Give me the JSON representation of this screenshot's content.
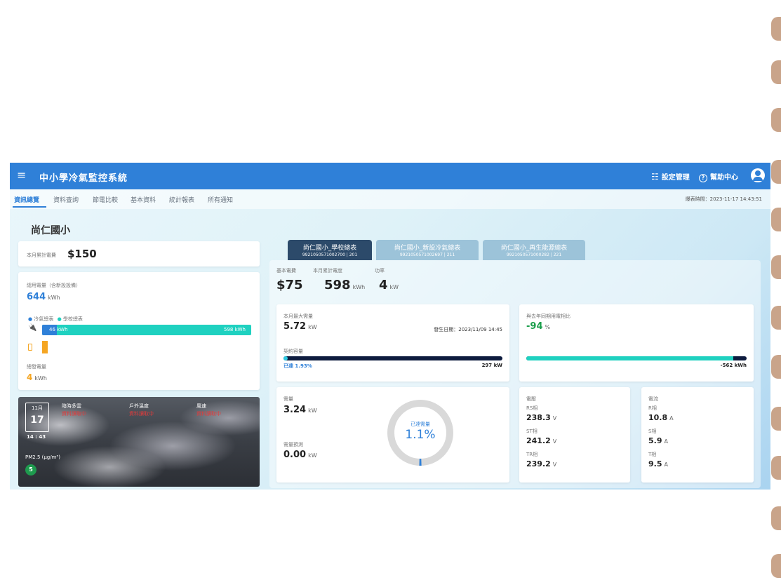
{
  "app": {
    "title": "中小學冷氣監控系統",
    "menu_icon": "hamburger-icon",
    "settings_label": "設定管理",
    "help_label": "幫助中心",
    "user_icon": "account-circle-icon"
  },
  "nav": {
    "tabs": [
      "資訊總覽",
      "資料查詢",
      "節電比較",
      "基本資料",
      "統計報表",
      "所有通知"
    ],
    "active_index": 0,
    "update_time": "爆表時間：2023-11-17 14:43:51"
  },
  "school_name": "尚仁國小",
  "left": {
    "monthly_cost_label": "本月累計電費",
    "monthly_cost": "$150",
    "usage_label": "總用電量（含新設設備）",
    "usage_value": "644",
    "usage_unit": "kWh",
    "legend_ac": "冷氣總表",
    "legend_school": "學校總表",
    "bar_ac_value": "46 kWh",
    "bar_school_value": "598 kWh",
    "bar_ac_fraction": 0.07,
    "gen_label": "總發電量",
    "gen_value": "4",
    "gen_unit": "kWh",
    "colors": {
      "ac": "#2f80d8",
      "school": "#1fd1c0",
      "gen": "#f5a623"
    }
  },
  "weather": {
    "month": "11月",
    "day": "17",
    "time": "14 : 43",
    "weather_label": "陰時多雲",
    "weather_value": "資料讀取中",
    "temp_label": "戶外溫度",
    "temp_value": "資料讀取中",
    "wind_label": "風速",
    "wind_value": "資料讀取中",
    "pm_label": "PM2.5 (μg/m³)",
    "pm_value": "5"
  },
  "meters": [
    {
      "name": "尚仁國小_學校總表",
      "code": "9921050571002700 | 201",
      "active": true
    },
    {
      "name": "尚仁國小_新設冷氣總表",
      "code": "9921050571002697 | 211",
      "active": false
    },
    {
      "name": "尚仁國小_再生能源總表",
      "code": "9921050571000282 | 221",
      "active": false
    }
  ],
  "summary": {
    "basic_fee_label": "基本電費",
    "basic_fee": "$75",
    "month_usage_label": "本月累計電度",
    "month_usage": "598",
    "month_usage_unit": "kWh",
    "power_label": "功率",
    "power": "4",
    "power_unit": "kW"
  },
  "max_demand": {
    "label": "本月最大需量",
    "value": "5.72",
    "unit": "kW",
    "date": "發生日期：2023/11/09 14:45",
    "contract_label": "契約容量",
    "used": "已達 1.93%",
    "used_fraction": 0.0193,
    "capacity": "297 kW"
  },
  "compare": {
    "label": "與去年同期用電相比",
    "value": "-94",
    "unit": "%",
    "diff": "-562 kWh",
    "fraction": 0.94
  },
  "demand": {
    "label": "需量",
    "value": "3.24",
    "unit": "kW",
    "forecast_label": "需量預測",
    "forecast_value": "0.00",
    "forecast_unit": "kW",
    "ring_label": "已達需量",
    "ring_value": "1.1%",
    "ring_fraction": 0.011
  },
  "voltage": {
    "title": "電壓",
    "items": [
      {
        "label": "RS相",
        "value": "238.3",
        "unit": "V"
      },
      {
        "label": "ST相",
        "value": "241.2",
        "unit": "V"
      },
      {
        "label": "TR相",
        "value": "239.2",
        "unit": "V"
      }
    ]
  },
  "current": {
    "title": "電流",
    "items": [
      {
        "label": "R相",
        "value": "10.8",
        "unit": "A"
      },
      {
        "label": "S相",
        "value": "5.9",
        "unit": "A"
      },
      {
        "label": "T相",
        "value": "9.5",
        "unit": "A"
      }
    ]
  }
}
